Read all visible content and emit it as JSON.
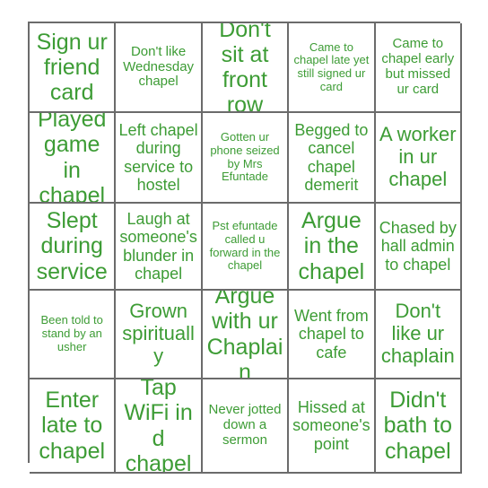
{
  "card": {
    "type": "bingo-card",
    "columns": 5,
    "rows": 5,
    "text_color": "#3d9c35",
    "grid_color": "#6b6b6b",
    "background_color": "#ffffff",
    "cells": [
      {
        "text": "Sign ur friend card",
        "size": "xl"
      },
      {
        "text": "Don't like Wednesday chapel",
        "size": "sm"
      },
      {
        "text": "Don't sit at front row",
        "size": "xl"
      },
      {
        "text": "Came to chapel late yet still signed ur card",
        "size": "xs"
      },
      {
        "text": "Came to chapel early but missed ur card",
        "size": "sm"
      },
      {
        "text": "Played game in chapel",
        "size": "xl"
      },
      {
        "text": "Left chapel during service to hostel",
        "size": "md"
      },
      {
        "text": "Gotten ur phone seized by Mrs Efuntade",
        "size": "xs"
      },
      {
        "text": "Begged to cancel chapel demerit",
        "size": "md"
      },
      {
        "text": "A worker in ur chapel",
        "size": "lg"
      },
      {
        "text": "Slept during service",
        "size": "xl"
      },
      {
        "text": "Laugh at someone's blunder in chapel",
        "size": "md"
      },
      {
        "text": "Pst efuntade called u forward in the chapel",
        "size": "xs"
      },
      {
        "text": "Argue in the chapel",
        "size": "xl"
      },
      {
        "text": "Chased by hall admin to chapel",
        "size": "md"
      },
      {
        "text": "Been told to stand by an usher",
        "size": "xs"
      },
      {
        "text": "Grown spiritually",
        "size": "lg"
      },
      {
        "text": "Argue with ur Chaplain",
        "size": "xl"
      },
      {
        "text": "Went from chapel to cafe",
        "size": "md"
      },
      {
        "text": "Don't like ur chaplain",
        "size": "lg"
      },
      {
        "text": "Enter late to chapel",
        "size": "xl"
      },
      {
        "text": "Tap WiFi in d chapel",
        "size": "xl"
      },
      {
        "text": "Never jotted down a sermon",
        "size": "sm"
      },
      {
        "text": "Hissed at someone's point",
        "size": "md"
      },
      {
        "text": "Didn't bath to chapel",
        "size": "xl"
      }
    ]
  }
}
